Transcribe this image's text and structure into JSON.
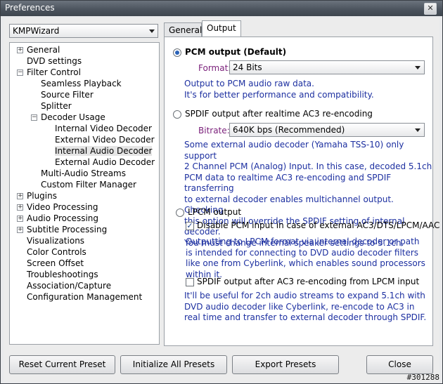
{
  "window": {
    "title": "Preferences",
    "close_symbol": "✕"
  },
  "preset": {
    "selected": "KMPWizard"
  },
  "tree": {
    "items": [
      {
        "label": "General",
        "expander": "+"
      },
      {
        "label": "DVD settings",
        "expander": ""
      },
      {
        "label": "Filter Control",
        "expander": "−"
      },
      {
        "label": "Seamless Playback",
        "expander": ""
      },
      {
        "label": "Source Filter",
        "expander": ""
      },
      {
        "label": "Splitter",
        "expander": ""
      },
      {
        "label": "Decoder Usage",
        "expander": "−"
      },
      {
        "label": "Internal Video Decoder",
        "expander": ""
      },
      {
        "label": "External Video Decoder",
        "expander": ""
      },
      {
        "label": "Internal Audio Decoder",
        "expander": "",
        "selected": true
      },
      {
        "label": "External Audio Decoder",
        "expander": ""
      },
      {
        "label": "Multi-Audio Streams",
        "expander": ""
      },
      {
        "label": "Custom Filter Manager",
        "expander": ""
      },
      {
        "label": "Plugins",
        "expander": "+"
      },
      {
        "label": "Video Processing",
        "expander": "+"
      },
      {
        "label": "Audio Processing",
        "expander": "+"
      },
      {
        "label": "Subtitle Processing",
        "expander": "+"
      },
      {
        "label": "Visualizations",
        "expander": ""
      },
      {
        "label": "Color Controls",
        "expander": ""
      },
      {
        "label": "Screen Offset",
        "expander": ""
      },
      {
        "label": "Troubleshootings",
        "expander": ""
      },
      {
        "label": "Association/Capture",
        "expander": ""
      },
      {
        "label": "Configuration Management",
        "expander": ""
      }
    ]
  },
  "tabs": [
    {
      "label": "General"
    },
    {
      "label": "Output",
      "active": true
    }
  ],
  "output": {
    "pcm": {
      "label": "PCM output (Default)",
      "checked": true,
      "format_label": "Format:",
      "format_value": "24 Bits",
      "note": "Output to PCM audio raw data.\nIt's for better performance and compatibility."
    },
    "spdif": {
      "label": "SPDIF output after realtime AC3 re-encoding",
      "checked": false,
      "bitrate_label": "Bitrate:",
      "bitrate_value": "640K bps (Recommended)",
      "note": "Some external audio decoder (Yamaha TSS-10) only support\n2 Channel PCM (Analog) Input. In this case, decoded 5.1ch\nPCM data to realtime AC3 re-encoding and SPDIF transferring\nto external decoder enables multichannel output. Checking\nthis option will override the SPDIF setting of internal decoder.\nYou must change internal speaker settings to 5.1ch."
    },
    "lpcm": {
      "label": "LPCM output",
      "checked": false,
      "disable_pcm_label": "Disable PCM input in case of external AC3/DTS/LPCM/AAC",
      "disable_pcm_checked": true,
      "note1": "Outputting to LPCM format via internal decoder or path\nis intended for connecting to DVD audio decoder filters\nlike one from Cyberlink, which enables sound processors\nwithin it.",
      "spdif_label": "SPDIF output after AC3 re-encoding from LPCM input",
      "spdif_checked": false,
      "note2": "It'll be useful for 2ch audio streams to expand 5.1ch with\nDVD audio decoder like Cyberlink, re-encode to AC3 in\nreal time and transfer to external decoder through SPDIF."
    }
  },
  "buttons": {
    "reset": "Reset Current Preset",
    "init": "Initialize All Presets",
    "export": "Export Presets",
    "close": "Close"
  },
  "watermark": "#301288",
  "colors": {
    "note_text": "#1c2fa0",
    "field_label": "#7a1f7a",
    "radio_accent": "#2b63b8"
  }
}
